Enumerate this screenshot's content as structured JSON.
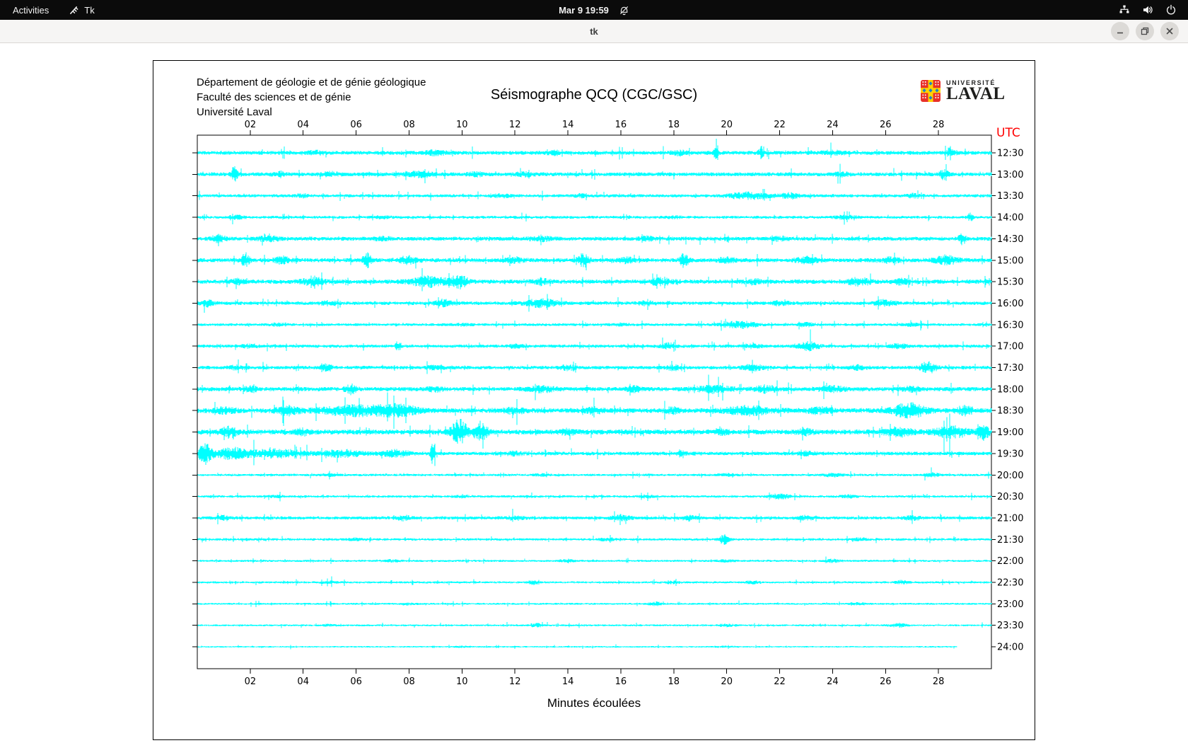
{
  "topbar": {
    "activities": "Activities",
    "app_name": "Tk",
    "clock": "Mar 9  19:59"
  },
  "titlebar": {
    "title": "tk"
  },
  "header": {
    "dept_lines": [
      "Département de géologie et de génie géologique",
      "Faculté des sciences et de génie",
      "Université Laval"
    ],
    "title": "Séismographe QCQ (CGC/GSC)"
  },
  "logo": {
    "line1": "UNIVERSITÉ",
    "line2": "LAVAL",
    "colors": {
      "red": "#e8302a",
      "gold": "#ffd200",
      "blue": "#1f83c6"
    }
  },
  "plot": {
    "utc_label": "UTC",
    "utc_color": "#ff0000",
    "xlabel": "Minutes écoulées",
    "trace_color": "#00ffff",
    "x_range": [
      0,
      30
    ],
    "minutes_ticks": [
      "02",
      "04",
      "06",
      "08",
      "10",
      "12",
      "14",
      "16",
      "18",
      "20",
      "22",
      "24",
      "26",
      "28"
    ],
    "rows": [
      {
        "time": "12:30",
        "base": 2.8,
        "events": [
          [
            4.5,
            2,
            0.3
          ],
          [
            9,
            2.5,
            0.4
          ],
          [
            13.5,
            2,
            0.3
          ],
          [
            18.2,
            3,
            0.25
          ],
          [
            19.6,
            20,
            0.07
          ],
          [
            21.3,
            8,
            0.09
          ],
          [
            24,
            2,
            0.4
          ],
          [
            28.4,
            5,
            0.15
          ]
        ]
      },
      {
        "time": "13:00",
        "base": 2.8,
        "events": [
          [
            1.4,
            10,
            0.12
          ],
          [
            3.1,
            3,
            0.2
          ],
          [
            5,
            2.5,
            0.3
          ],
          [
            8.4,
            3,
            0.5
          ],
          [
            10.5,
            2.5,
            0.3
          ],
          [
            12.4,
            2.5,
            0.3
          ],
          [
            24.3,
            2.5,
            0.3
          ],
          [
            28.2,
            7,
            0.15
          ]
        ]
      },
      {
        "time": "13:30",
        "base": 2.2,
        "events": [
          [
            4,
            1.5,
            0.3
          ],
          [
            11.5,
            2,
            0.3
          ],
          [
            14.5,
            1.5,
            0.3
          ],
          [
            20.8,
            4,
            0.8
          ],
          [
            22.4,
            3,
            0.4
          ],
          [
            27,
            2,
            0.3
          ]
        ]
      },
      {
        "time": "14:00",
        "base": 2.0,
        "events": [
          [
            1.5,
            2,
            0.3
          ],
          [
            7,
            1.5,
            0.3
          ],
          [
            18,
            1.5,
            0.3
          ],
          [
            24.5,
            2,
            0.4
          ],
          [
            29.2,
            6,
            0.1
          ]
        ]
      },
      {
        "time": "14:30",
        "base": 2.8,
        "events": [
          [
            0.8,
            3.5,
            0.3
          ],
          [
            2.7,
            3,
            0.4
          ],
          [
            7,
            2,
            0.3
          ],
          [
            13,
            2.5,
            0.4
          ],
          [
            17,
            2,
            0.3
          ],
          [
            22,
            2,
            0.3
          ],
          [
            28.9,
            8,
            0.12
          ]
        ]
      },
      {
        "time": "15:00",
        "base": 3.0,
        "events": [
          [
            1.8,
            9,
            0.15
          ],
          [
            3.2,
            4,
            0.3
          ],
          [
            6.4,
            10,
            0.15
          ],
          [
            7.9,
            5,
            0.3
          ],
          [
            12,
            3,
            0.3
          ],
          [
            14.6,
            9,
            0.18
          ],
          [
            16.2,
            3,
            0.3
          ],
          [
            18.4,
            9,
            0.15
          ],
          [
            20,
            3,
            0.3
          ],
          [
            23,
            3.5,
            0.4
          ],
          [
            26.2,
            3,
            0.3
          ],
          [
            28.3,
            5,
            0.4
          ]
        ]
      },
      {
        "time": "15:30",
        "base": 3.0,
        "events": [
          [
            1.5,
            3,
            0.3
          ],
          [
            4.4,
            4,
            0.5
          ],
          [
            8.8,
            6,
            0.7
          ],
          [
            9.9,
            8,
            0.3
          ],
          [
            13,
            3,
            0.3
          ],
          [
            17.5,
            4,
            0.4
          ],
          [
            21,
            3,
            0.3
          ],
          [
            25,
            4.5,
            0.4
          ],
          [
            26.6,
            3.5,
            0.3
          ]
        ]
      },
      {
        "time": "16:00",
        "base": 2.5,
        "events": [
          [
            0.4,
            4,
            0.25
          ],
          [
            5,
            2.5,
            0.3
          ],
          [
            9.3,
            4,
            0.3
          ],
          [
            13,
            5,
            0.6
          ],
          [
            17,
            2.5,
            0.3
          ],
          [
            22,
            2.5,
            0.3
          ],
          [
            26,
            4,
            0.35
          ]
        ]
      },
      {
        "time": "16:30",
        "base": 2.0,
        "events": [
          [
            3,
            1.5,
            0.3
          ],
          [
            10,
            1.5,
            0.3
          ],
          [
            16,
            1.5,
            0.3
          ],
          [
            20.5,
            4.5,
            0.6
          ],
          [
            23,
            2.5,
            0.3
          ],
          [
            27,
            1.5,
            0.3
          ]
        ]
      },
      {
        "time": "17:00",
        "base": 2.3,
        "events": [
          [
            2,
            2,
            0.3
          ],
          [
            7.6,
            7,
            0.1
          ],
          [
            12,
            2,
            0.3
          ],
          [
            17.8,
            3.5,
            0.3
          ],
          [
            21,
            2.5,
            0.3
          ],
          [
            23.1,
            5,
            0.4
          ],
          [
            26.5,
            2.5,
            0.3
          ]
        ]
      },
      {
        "time": "17:30",
        "base": 2.5,
        "events": [
          [
            1.5,
            2,
            0.3
          ],
          [
            4.9,
            4.5,
            0.2
          ],
          [
            9,
            2,
            0.3
          ],
          [
            14,
            2.5,
            0.3
          ],
          [
            18,
            2.5,
            0.3
          ],
          [
            21,
            3.5,
            0.4
          ],
          [
            25,
            2.5,
            0.3
          ],
          [
            27.6,
            7,
            0.3
          ]
        ]
      },
      {
        "time": "18:00",
        "base": 3.0,
        "events": [
          [
            2,
            2.5,
            0.3
          ],
          [
            5.8,
            6,
            0.2
          ],
          [
            9,
            2.5,
            0.3
          ],
          [
            13,
            3.5,
            0.5
          ],
          [
            16.5,
            3,
            0.3
          ],
          [
            19.5,
            4,
            0.6
          ],
          [
            21.5,
            4,
            0.4
          ],
          [
            24,
            3,
            0.5
          ],
          [
            27,
            2.5,
            0.3
          ]
        ]
      },
      {
        "time": "18:30",
        "base": 3.5,
        "events": [
          [
            1,
            3,
            0.4
          ],
          [
            3.4,
            5,
            0.4
          ],
          [
            6,
            6,
            1.3
          ],
          [
            7.6,
            6,
            0.7
          ],
          [
            12,
            3,
            0.4
          ],
          [
            15,
            3,
            0.3
          ],
          [
            18,
            3,
            0.3
          ],
          [
            20.8,
            5,
            0.8
          ],
          [
            23.5,
            3.5,
            0.4
          ],
          [
            26.9,
            9,
            0.6
          ],
          [
            29,
            5,
            0.3
          ]
        ]
      },
      {
        "time": "19:00",
        "base": 3.5,
        "events": [
          [
            1.2,
            6,
            0.3
          ],
          [
            4,
            3,
            0.3
          ],
          [
            9.9,
            16,
            0.3
          ],
          [
            10.7,
            10,
            0.3
          ],
          [
            14,
            3,
            0.3
          ],
          [
            19.8,
            5,
            0.2
          ],
          [
            23,
            3,
            0.3
          ],
          [
            26.5,
            5,
            0.5
          ],
          [
            28.5,
            7,
            0.6
          ],
          [
            29.7,
            9,
            0.2
          ]
        ]
      },
      {
        "time": "19:30",
        "base": 2.6,
        "events": [
          [
            0.3,
            13,
            0.25
          ],
          [
            1.3,
            7,
            0.6
          ],
          [
            3,
            5,
            1.0
          ],
          [
            5.5,
            4,
            0.8
          ],
          [
            7.5,
            4,
            0.5
          ],
          [
            8.9,
            15,
            0.08
          ],
          [
            12,
            2,
            0.3
          ],
          [
            18.3,
            5,
            0.12
          ],
          [
            23,
            2,
            0.3
          ]
        ]
      },
      {
        "time": "20:00",
        "base": 1.7,
        "events": [
          [
            5,
            1.2,
            0.3
          ],
          [
            13,
            1.2,
            0.3
          ],
          [
            20,
            1.5,
            0.3
          ],
          [
            24,
            2,
            0.4
          ],
          [
            27.8,
            2.5,
            0.3
          ]
        ]
      },
      {
        "time": "20:30",
        "base": 1.7,
        "events": [
          [
            3,
            1.2,
            0.3
          ],
          [
            10,
            1.2,
            0.3
          ],
          [
            17,
            1.5,
            0.3
          ],
          [
            22,
            2.8,
            0.4
          ],
          [
            24.6,
            2,
            0.3
          ]
        ]
      },
      {
        "time": "21:00",
        "base": 2.3,
        "events": [
          [
            1,
            3,
            0.25
          ],
          [
            7.8,
            2.8,
            0.3
          ],
          [
            12,
            2,
            0.3
          ],
          [
            16,
            2.5,
            0.4
          ],
          [
            18.6,
            2.8,
            0.25
          ],
          [
            23,
            2,
            0.3
          ],
          [
            27,
            2,
            0.3
          ]
        ]
      },
      {
        "time": "21:30",
        "base": 1.7,
        "events": [
          [
            6,
            1.5,
            0.3
          ],
          [
            15.5,
            2,
            0.3
          ],
          [
            19.9,
            6.5,
            0.18
          ],
          [
            25,
            1.5,
            0.3
          ]
        ]
      },
      {
        "time": "22:00",
        "base": 1.5,
        "events": [
          [
            7.4,
            1.5,
            0.3
          ],
          [
            14,
            1.2,
            0.3
          ],
          [
            20,
            1.2,
            0.3
          ],
          [
            24,
            1.6,
            0.3
          ]
        ]
      },
      {
        "time": "22:30",
        "base": 1.5,
        "events": [
          [
            5,
            1.2,
            0.3
          ],
          [
            12.7,
            2.6,
            0.2
          ],
          [
            18,
            1.2,
            0.3
          ],
          [
            21,
            1.5,
            0.3
          ],
          [
            26.6,
            2.2,
            0.25
          ]
        ]
      },
      {
        "time": "23:00",
        "base": 1.4,
        "events": [
          [
            8,
            1.2,
            0.3
          ],
          [
            17.3,
            2.2,
            0.25
          ],
          [
            25,
            1.3,
            0.3
          ]
        ]
      },
      {
        "time": "23:30",
        "base": 1.4,
        "events": [
          [
            5,
            1.2,
            0.3
          ],
          [
            12.8,
            2.2,
            0.25
          ],
          [
            20,
            1.3,
            0.3
          ],
          [
            26.5,
            2.2,
            0.3
          ]
        ]
      },
      {
        "time": "24:00",
        "base": 1.1,
        "end": 28.7,
        "events": [
          [
            10,
            0.6,
            0.5
          ],
          [
            20,
            0.6,
            0.5
          ]
        ]
      }
    ]
  }
}
